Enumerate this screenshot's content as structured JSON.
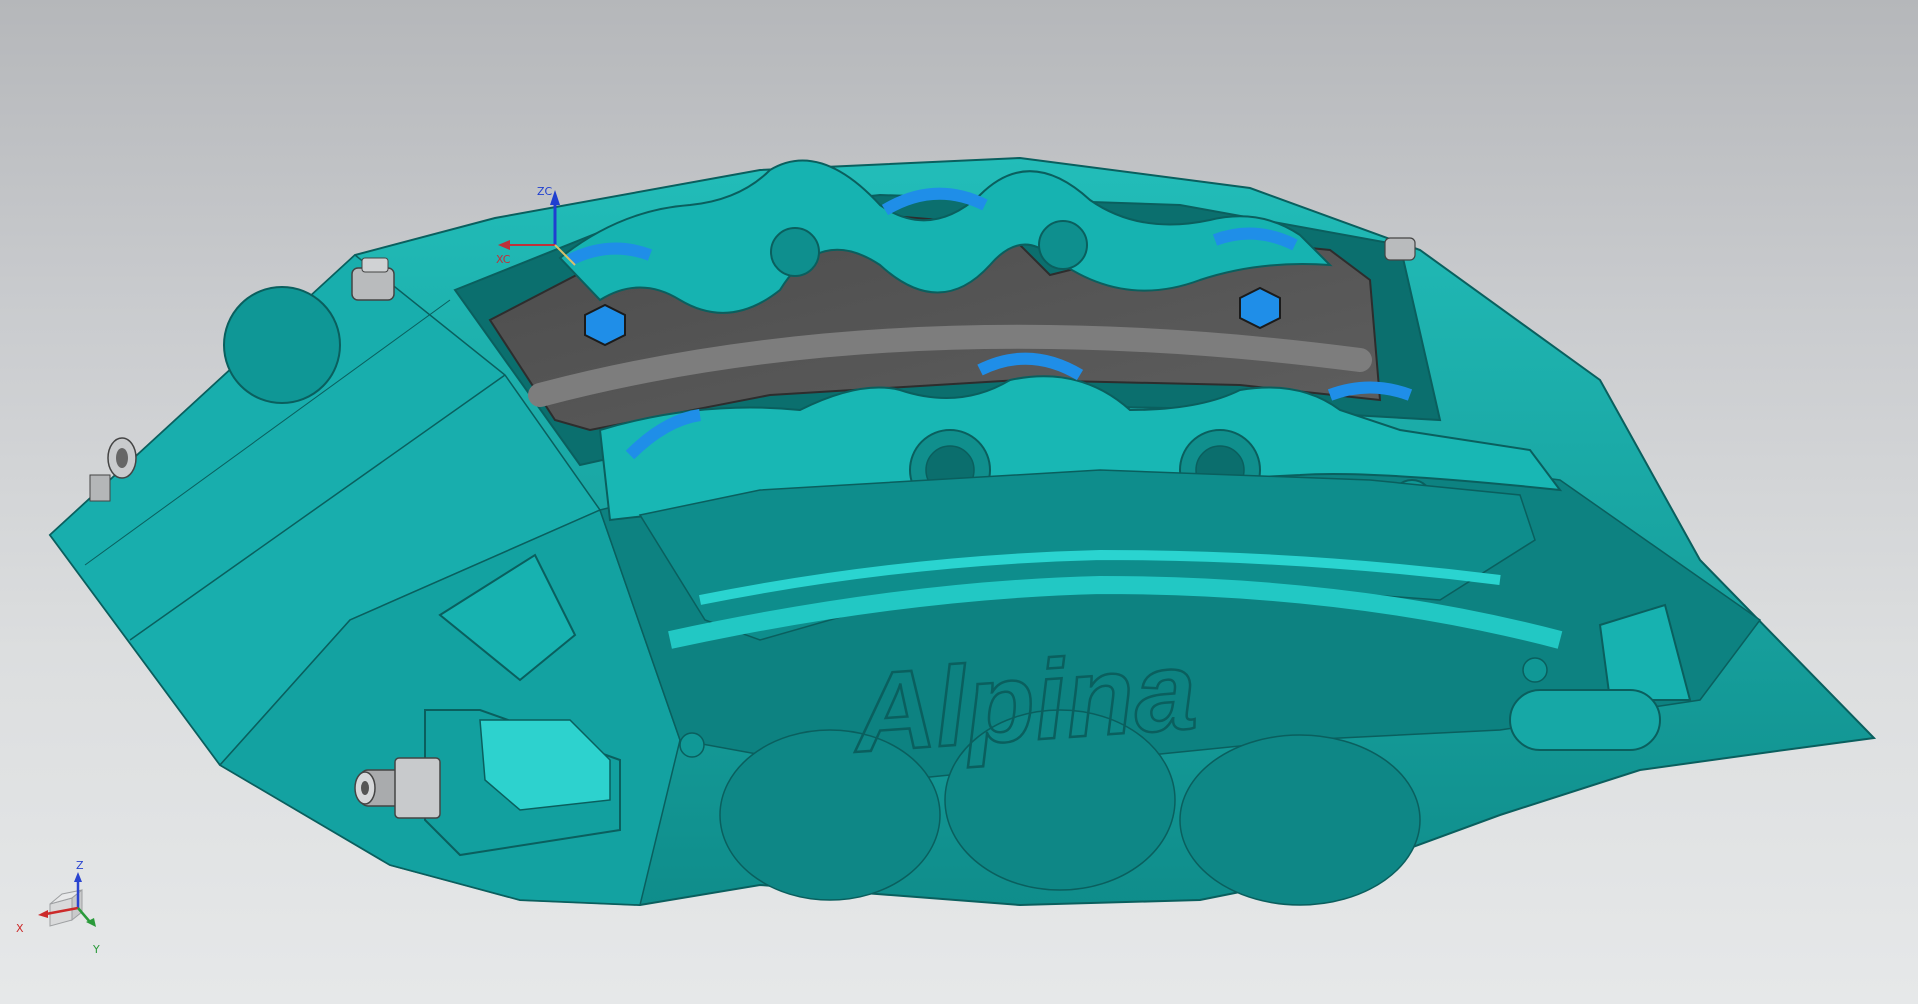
{
  "viewport": {
    "background_top": "#b5b7ba",
    "background_bottom": "#e6e8e9"
  },
  "model": {
    "body_color": "#14a7a6",
    "body_dark": "#0f8786",
    "body_light": "#27c6c3",
    "highlight_color": "#38e0da",
    "pad_color": "#555555",
    "pad_edge_color": "#7c7c7c",
    "piston_accent_color": "#1f8ee8",
    "engraved_logo": "Alpina"
  },
  "wcs": {
    "z_label": "ZC",
    "x_label": "XC",
    "z_color": "#1f3fd0",
    "x_color": "#c0303a"
  },
  "view_triad": {
    "x_label": "X",
    "y_label": "Y",
    "z_label": "Z",
    "x_color": "#cc2a2a",
    "y_color": "#2a9a3a",
    "z_color": "#2a44d0",
    "cube_icon": "view-cube-icon"
  }
}
